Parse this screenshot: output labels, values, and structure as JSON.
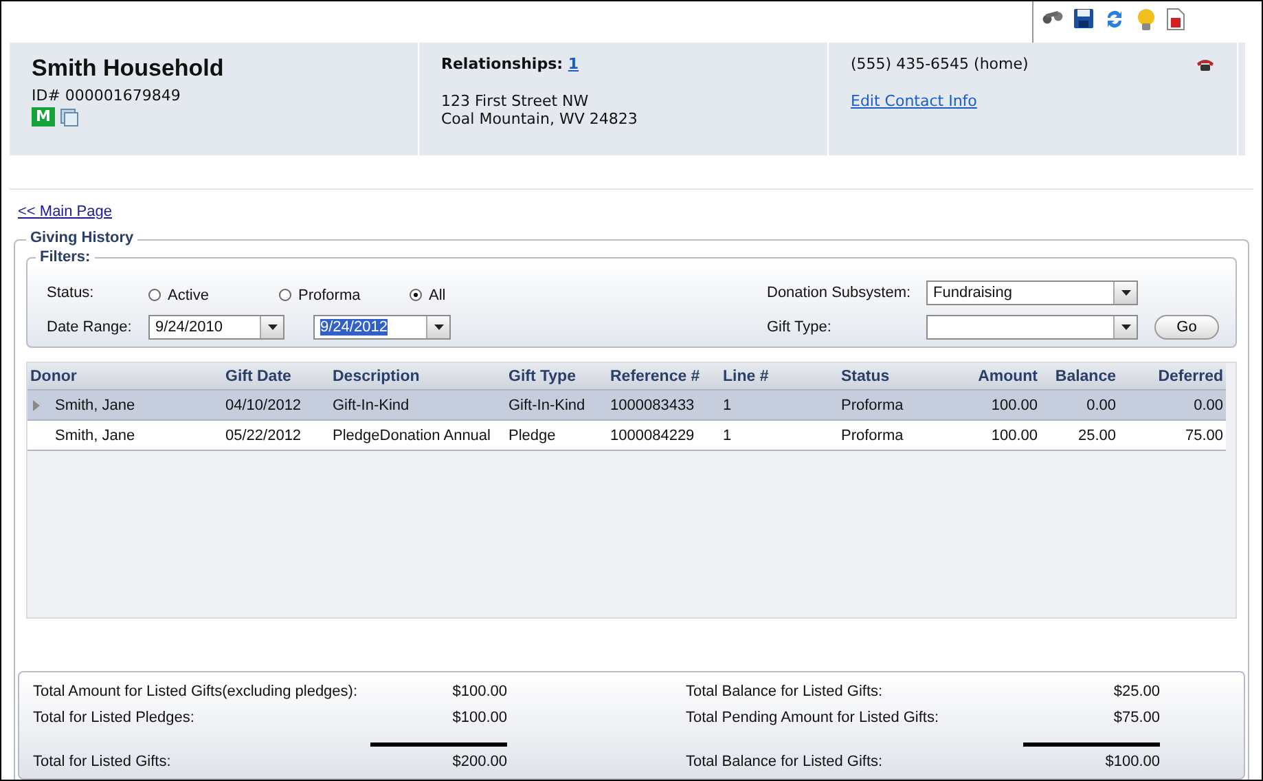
{
  "household": {
    "name": "Smith Household",
    "id": "ID# 000001679849",
    "badge": "M"
  },
  "relationships": {
    "label": "Relationships:",
    "count": "1",
    "address": [
      "123 First Street NW",
      "Coal Mountain, WV 24823"
    ]
  },
  "contact": {
    "phone": "(555) 435-6545 (home)",
    "edit_link": "Edit Contact Info"
  },
  "back_link": "<< Main Page",
  "section_title": "Giving History",
  "filters": {
    "title": "Filters:",
    "status_label": "Status:",
    "status_options": [
      {
        "label": "Active",
        "selected": false
      },
      {
        "label": "Proforma",
        "selected": false
      },
      {
        "label": "All",
        "selected": true
      }
    ],
    "date_range_label": "Date Range:",
    "date_from": {
      "value": "9/24/2010",
      "text_selected": false
    },
    "date_to": {
      "value": "9/24/2012",
      "text_selected": true
    },
    "subsystem_label": "Donation Subsystem:",
    "subsystem_value": "Fundraising",
    "gift_type_label": "Gift Type:",
    "go_button": "Go"
  },
  "table": {
    "columns": [
      "Donor",
      "Gift Date",
      "Description",
      "Gift Type",
      "Reference #",
      "Line #",
      "Status",
      "Amount",
      "Balance",
      "Deferred"
    ],
    "rows": [
      {
        "selected": true,
        "cells": [
          "Smith, Jane",
          "04/10/2012",
          "Gift-In-Kind",
          "Gift-In-Kind",
          "1000083433",
          "1",
          "Proforma",
          "100.00",
          "0.00",
          "0.00"
        ]
      },
      {
        "selected": false,
        "cells": [
          "Smith, Jane",
          "05/22/2012",
          "PledgeDonation Annual",
          "Pledge",
          "1000084229",
          "1",
          "Proforma",
          "100.00",
          "25.00",
          "75.00"
        ]
      }
    ]
  },
  "totals": [
    [
      {
        "kind": "line",
        "label": "Total Amount for Listed Gifts(excluding pledges):",
        "value": "$100.00"
      },
      {
        "kind": "line",
        "label": "Total for Listed Pledges:",
        "value": "$100.00"
      },
      {
        "kind": "sum",
        "label": "Total for Listed Gifts:",
        "value": "$200.00"
      }
    ],
    [
      {
        "kind": "line",
        "label": "Total Balance for Listed Gifts:",
        "value": "$25.00"
      },
      {
        "kind": "line",
        "label": "Total Pending Amount for Listed Gifts:",
        "value": "$75.00"
      },
      {
        "kind": "sum",
        "label": "Total Balance for Listed Gifts:",
        "value": "$100.00"
      }
    ]
  ]
}
